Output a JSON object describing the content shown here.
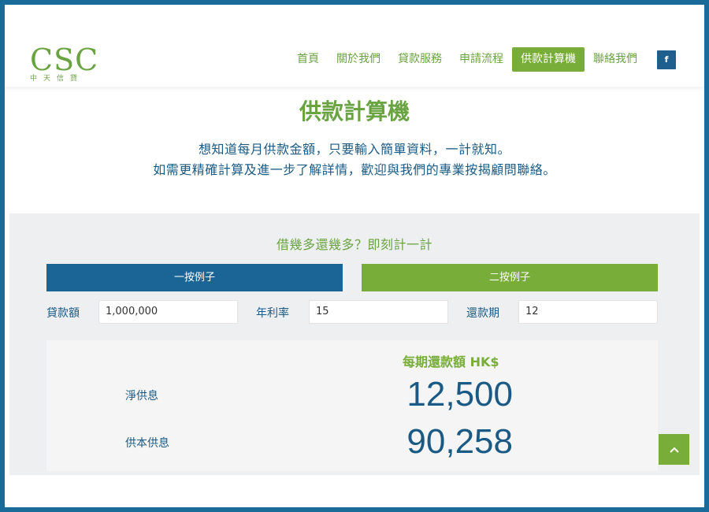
{
  "logo": {
    "main": "CSC",
    "sub": "中天信貸"
  },
  "nav": {
    "items": [
      {
        "label": "首頁",
        "name": "nav-home",
        "active": false
      },
      {
        "label": "關於我們",
        "name": "nav-about",
        "active": false
      },
      {
        "label": "貸款服務",
        "name": "nav-loan-services",
        "active": false
      },
      {
        "label": "申請流程",
        "name": "nav-application-process",
        "active": false
      },
      {
        "label": "供款計算機",
        "name": "nav-calculator",
        "active": true
      },
      {
        "label": "聯絡我們",
        "name": "nav-contact",
        "active": false
      }
    ],
    "facebook_icon": "facebook-icon",
    "facebook_glyph": "f"
  },
  "page": {
    "title": "供款計算機",
    "intro_line1": "想知道每月供款金額，只要輸入簡單資料，一計就知。",
    "intro_line2": "如需更精確計算及進一步了解詳情，歡迎與我們的專業按揭顧問聯絡。"
  },
  "calculator": {
    "heading": "借幾多還幾多？即刻計一計",
    "button_blue": "一按例子",
    "button_green": "二按例子",
    "fields": {
      "amount_label": "貸款額",
      "amount_value": "1,000,000",
      "rate_label": "年利率",
      "rate_value": "15",
      "term_label": "還款期",
      "term_value": "12"
    },
    "result": {
      "heading": "每期還款額 HK$",
      "interest_label": "淨供息",
      "interest_value": "12,500",
      "principal_interest_label": "供本供息",
      "principal_interest_value": "90,258"
    }
  },
  "back_to_top_icon": "chevron-up-icon",
  "colors": {
    "brand_green": "#79ad3a",
    "brand_blue": "#1a6596",
    "text_blue": "#1a5a85",
    "frame_border": "#1a6a9a"
  }
}
